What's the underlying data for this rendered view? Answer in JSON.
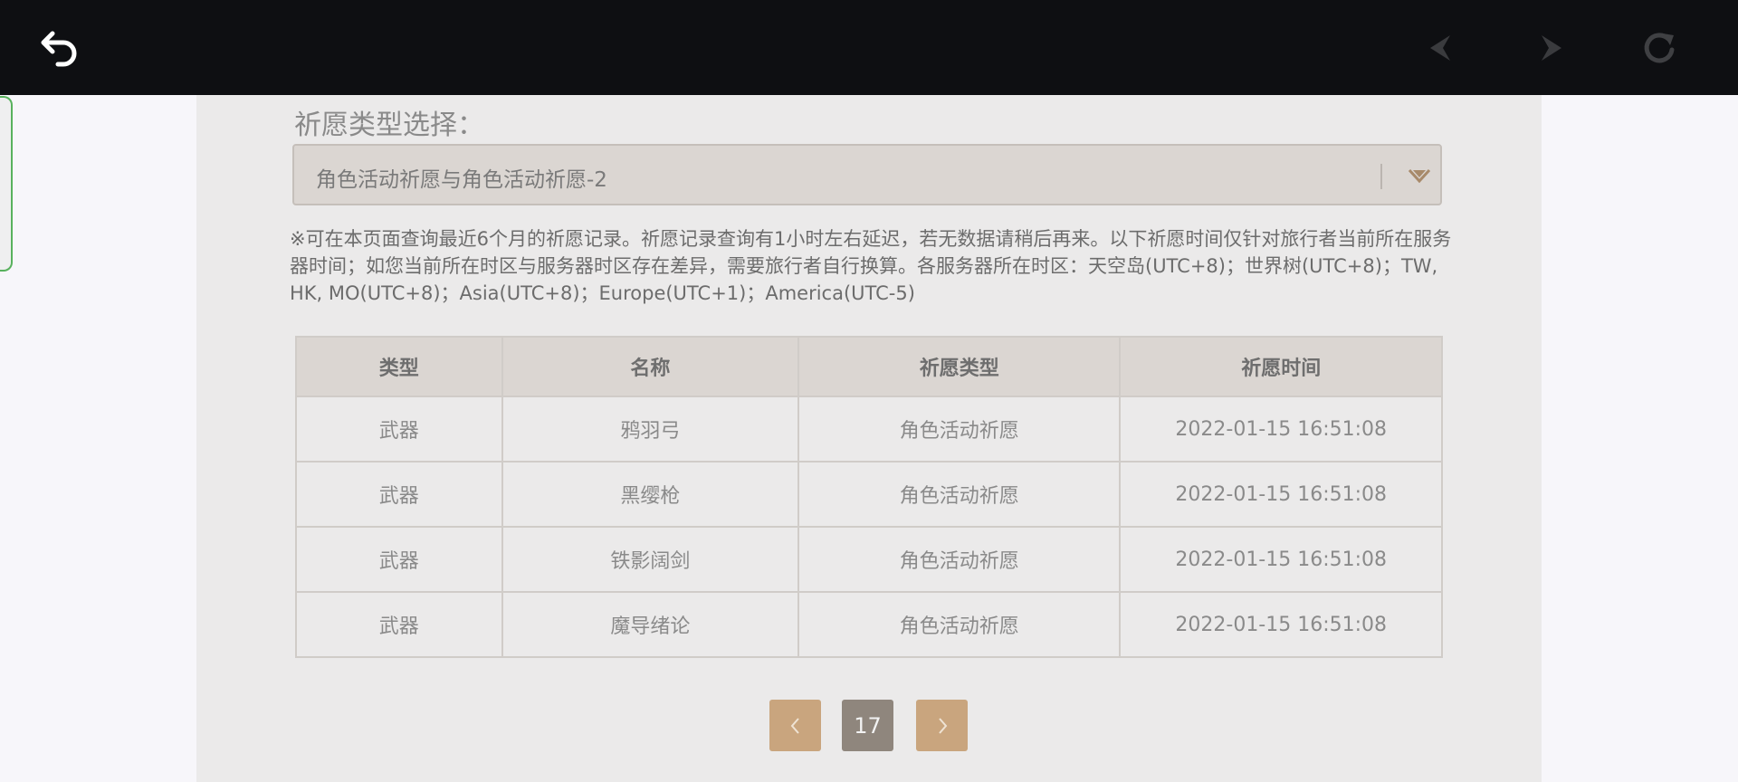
{
  "selector": {
    "label": "祈愿类型选择：",
    "value": "角色活动祈愿与角色活动祈愿-2"
  },
  "notice": "※可在本页面查询最近6个月的祈愿记录。祈愿记录查询有1小时左右延迟，若无数据请稍后再来。以下祈愿时间仅针对旅行者当前所在服务器时间；如您当前所在时区与服务器时区存在差异，需要旅行者自行换算。各服务器所在时区：天空岛(UTC+8)；世界树(UTC+8)；TW, HK, MO(UTC+8)；Asia(UTC+8)；Europe(UTC+1)；America(UTC-5)",
  "table": {
    "headers": [
      "类型",
      "名称",
      "祈愿类型",
      "祈愿时间"
    ],
    "rows": [
      [
        "武器",
        "鸦羽弓",
        "角色活动祈愿",
        "2022-01-15 16:51:08"
      ],
      [
        "武器",
        "黑缨枪",
        "角色活动祈愿",
        "2022-01-15 16:51:08"
      ],
      [
        "武器",
        "铁影阔剑",
        "角色活动祈愿",
        "2022-01-15 16:51:08"
      ],
      [
        "武器",
        "魔导绪论",
        "角色活动祈愿",
        "2022-01-15 16:51:08"
      ]
    ]
  },
  "pagination": {
    "current_page": "17"
  },
  "icons": {
    "back": "back-arrow-icon",
    "prev": "prev-page-icon",
    "next": "next-page-icon",
    "reload": "reload-icon"
  },
  "colors": {
    "topbar": "#0e0f12",
    "panel": "#ebeaea",
    "accent": "#c9a57e",
    "active_page": "#8f867d"
  }
}
